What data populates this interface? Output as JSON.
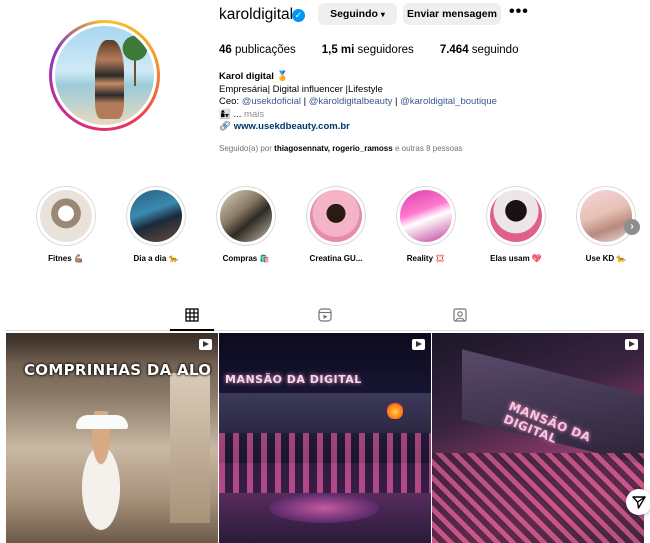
{
  "profile": {
    "username": "karoldigital",
    "following_label": "Seguindo",
    "message_label": "Enviar mensagem",
    "more_label": "•••",
    "stats": [
      {
        "value": "46",
        "label": "publicações"
      },
      {
        "value": "1,5 mi",
        "label": "seguidores"
      },
      {
        "value": "7.464",
        "label": "seguindo"
      }
    ],
    "bio": {
      "name": "Karol digital 🏅",
      "line1": "Empresária| Digital influencer |Lifestyle",
      "line2_prefix": "Ceo: ",
      "line2_links": [
        "@usekdoficial",
        "@karoldigitalbeauty",
        "@karoldigital_boutique"
      ],
      "line2_sep": " | ",
      "line3": "👩‍👧 ...",
      "more": " mais",
      "url": "www.usekdbeauty.com.br"
    },
    "followed_by": {
      "prefix": "Seguido(a) por ",
      "names": "thiagosennatv, rogerio_ramoss",
      "suffix": " e outras 8 pessoas"
    }
  },
  "highlights": [
    {
      "label": "Fitnes 💪🏽",
      "bg": "radial-gradient(circle at 50% 45%, #ffffff 0 20%, #9a8876 21% 38%, #e8e2da 39%)"
    },
    {
      "label": "Dia a dia 🐆",
      "bg": "linear-gradient(160deg, #2a5d80 0%, #3a8ab0 40%, #1b2a3a 60%, #6a4c3a 100%)"
    },
    {
      "label": "Compras 🛍️",
      "bg": "linear-gradient(140deg, #d9d2c6 0%, #8a7a63 40%, #2d2a26 60%, #cbbfa8 100%)"
    },
    {
      "label": "Creatina GU...",
      "bg": "radial-gradient(circle at 50% 45%, #2a1a14 0 24%, #f2b4c6 25% 60%, #e88aa8 61%)"
    },
    {
      "label": "Reality 💢",
      "bg": "linear-gradient(160deg, #d63fa8 0%, #ff7ad0 40%, #ffffff 55%, #c23c96 100%)"
    },
    {
      "label": "Elas usam 💖",
      "bg": "radial-gradient(circle at 50% 40%, #1a1212 0 26%, #ece6e8 27% 55%, #e05f8c 56%)"
    },
    {
      "label": "Use KD 🐆",
      "bg": "linear-gradient(160deg, #f4d6da 0%, #e7c1b6 45%, #b78a7c 70%, #f0e2e2 100%)"
    }
  ],
  "tabs": [
    {
      "name": "tab-posts",
      "icon": "grid-icon"
    },
    {
      "name": "tab-reels",
      "icon": "reels-icon"
    },
    {
      "name": "tab-tagged",
      "icon": "tagged-icon"
    }
  ],
  "posts": [
    {
      "title": "COMPRINHAS DA ALO",
      "type": "reel"
    },
    {
      "title": "MANSÃO DA DIGITAL",
      "type": "reel"
    },
    {
      "title": "MANSÃO DA DIGITAL",
      "type": "reel"
    }
  ]
}
